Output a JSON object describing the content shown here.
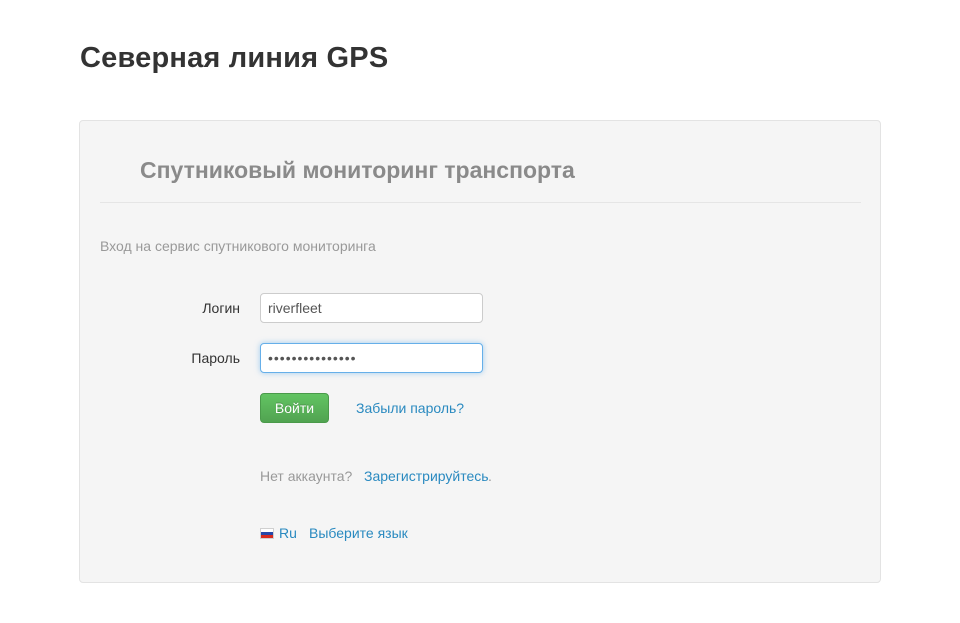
{
  "header": {
    "title": "Северная линия GPS"
  },
  "panel": {
    "heading": "Спутниковый мониторинг транспорта",
    "intro": "Вход на сервис спутникового мониторинга"
  },
  "form": {
    "login_label": "Логин",
    "login_value": "riverfleet",
    "password_label": "Пароль",
    "password_value": "•••••••••••••••",
    "submit_label": "Войти",
    "forgot_label": "Забыли пароль?"
  },
  "register": {
    "prompt": "Нет аккаунта?",
    "link_label": "Зарегистрируйтесь",
    "suffix": "."
  },
  "language": {
    "code": "Ru",
    "select_label": "Выберите язык",
    "flag_icon": "russia-flag-icon"
  },
  "colors": {
    "accent_link": "#2a8ac0",
    "button_green": "#5bb75b",
    "focus_border": "#66afe9"
  }
}
